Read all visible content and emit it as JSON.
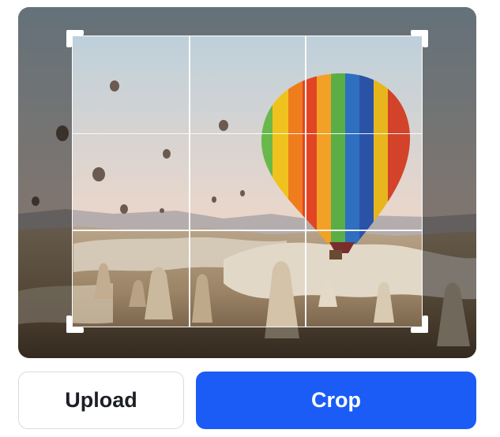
{
  "image": {
    "description_icon": "photo-hot-air-balloons"
  },
  "crop": {
    "grid": "rule-of-thirds"
  },
  "buttons": {
    "upload_label": "Upload",
    "crop_label": "Crop"
  },
  "colors": {
    "primary": "#1a5cf5",
    "secondary_border": "#d9dce1",
    "text_dark": "#1c1f24"
  }
}
